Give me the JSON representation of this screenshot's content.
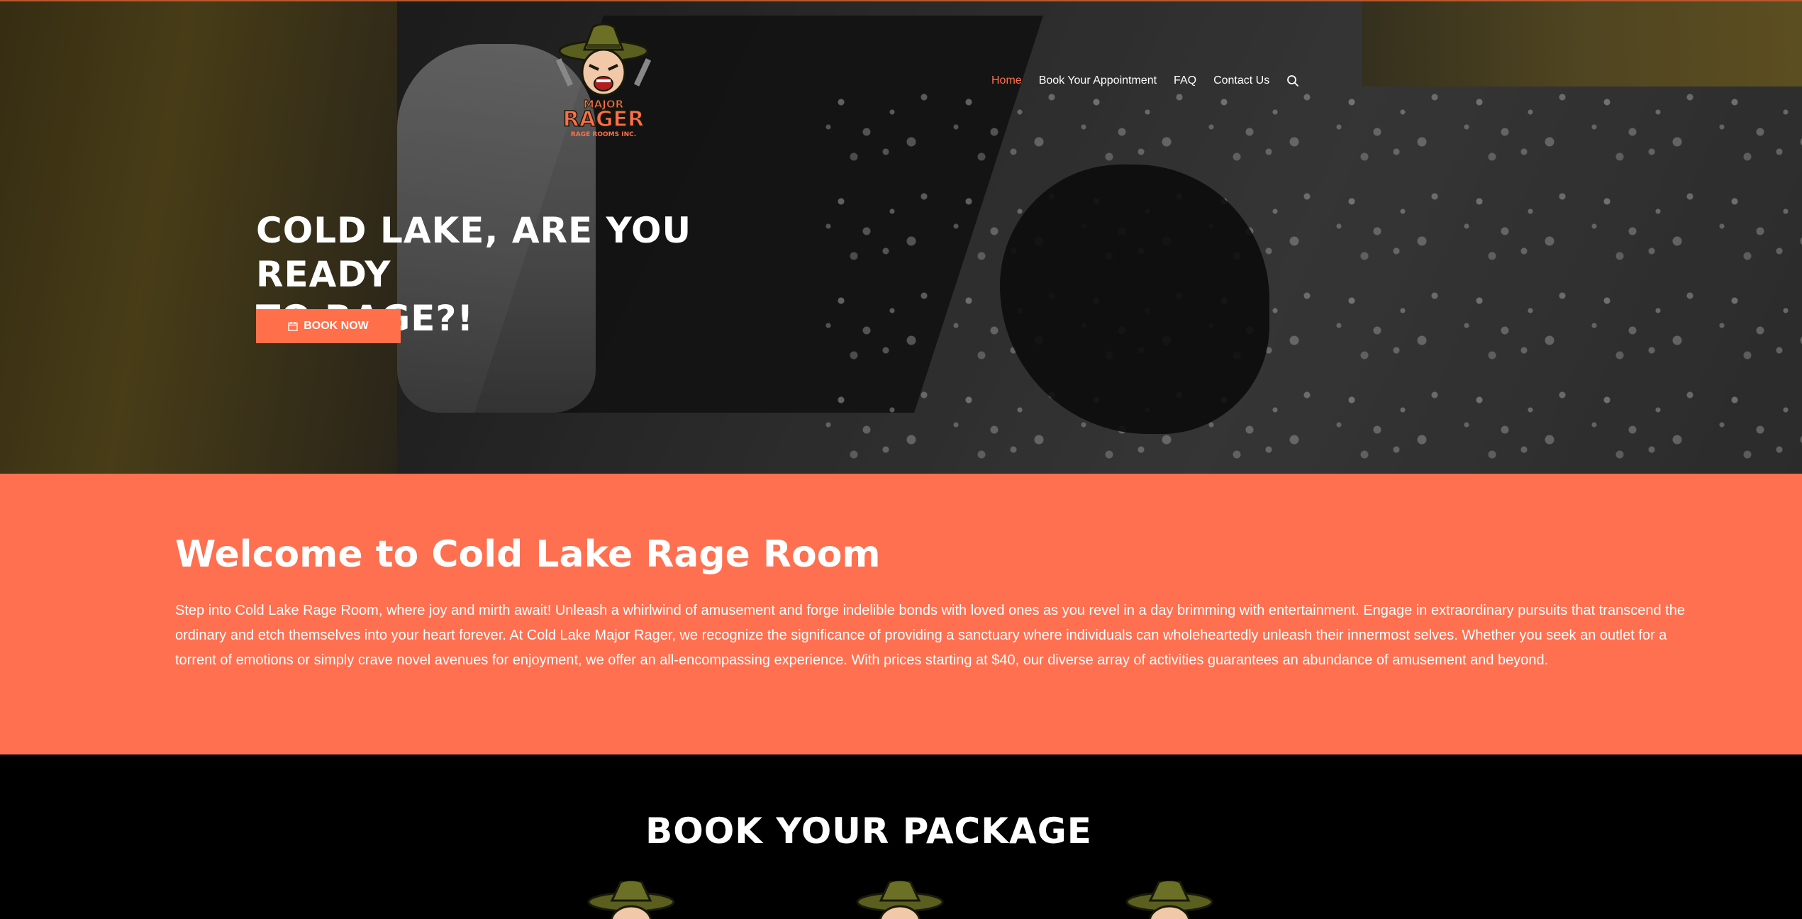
{
  "brand": {
    "logo_top": "MAJOR",
    "logo_main": "RAGER",
    "logo_sub": "RAGE ROOMS INC.",
    "accent": "#ff6f4a",
    "welcome_bg": "#ff7050"
  },
  "nav": {
    "items": [
      {
        "label": "Home",
        "active": true
      },
      {
        "label": "Book Your Appointment",
        "active": false
      },
      {
        "label": "FAQ",
        "active": false
      },
      {
        "label": "Contact Us",
        "active": false
      }
    ],
    "search_icon": "search-icon"
  },
  "hero": {
    "title_line1": "COLD LAKE, ARE YOU READY",
    "title_line2": "TO RAGE?!",
    "button_label": "BOOK NOW",
    "button_icon": "calendar-icon"
  },
  "welcome": {
    "heading": "Welcome to Cold Lake Rage Room",
    "body": "Step into Cold Lake Rage Room, where joy and mirth await! Unleash a whirlwind of amusement and forge indelible bonds with loved ones as you revel in a day brimming with entertainment. Engage in extraordinary pursuits that transcend the ordinary and etch themselves into your heart forever. At Cold Lake Major Rager, we recognize the significance of providing a sanctuary where individuals can wholeheartedly unleash their innermost selves. Whether you seek an outlet for a torrent of emotions or simply crave novel avenues for enjoyment, we offer an all-encompassing experience. With prices starting at $40, our diverse array of activities guarantees an abundance of amusement and beyond."
  },
  "packages": {
    "heading": "BOOK YOUR PACKAGE"
  }
}
